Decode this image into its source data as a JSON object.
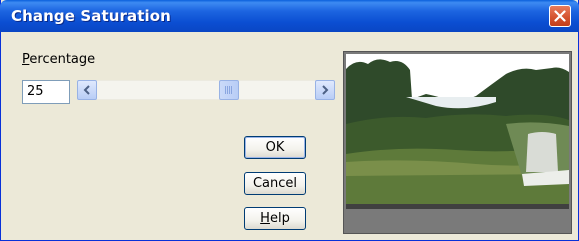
{
  "window": {
    "title": "Change Saturation"
  },
  "percentage": {
    "label_accel": "P",
    "label_rest": "ercentage",
    "value": "25",
    "slider_fraction": 0.62
  },
  "buttons": {
    "ok": "OK",
    "cancel": "Cancel",
    "help_accel": "H",
    "help_rest": "elp"
  },
  "colors": {
    "titlebar": "#0a4fd4",
    "close": "#d3512d",
    "dialog_bg": "#ece9d8"
  },
  "icons": [
    "close-icon",
    "arrow-left-icon",
    "arrow-right-icon",
    "grip-icon"
  ]
}
